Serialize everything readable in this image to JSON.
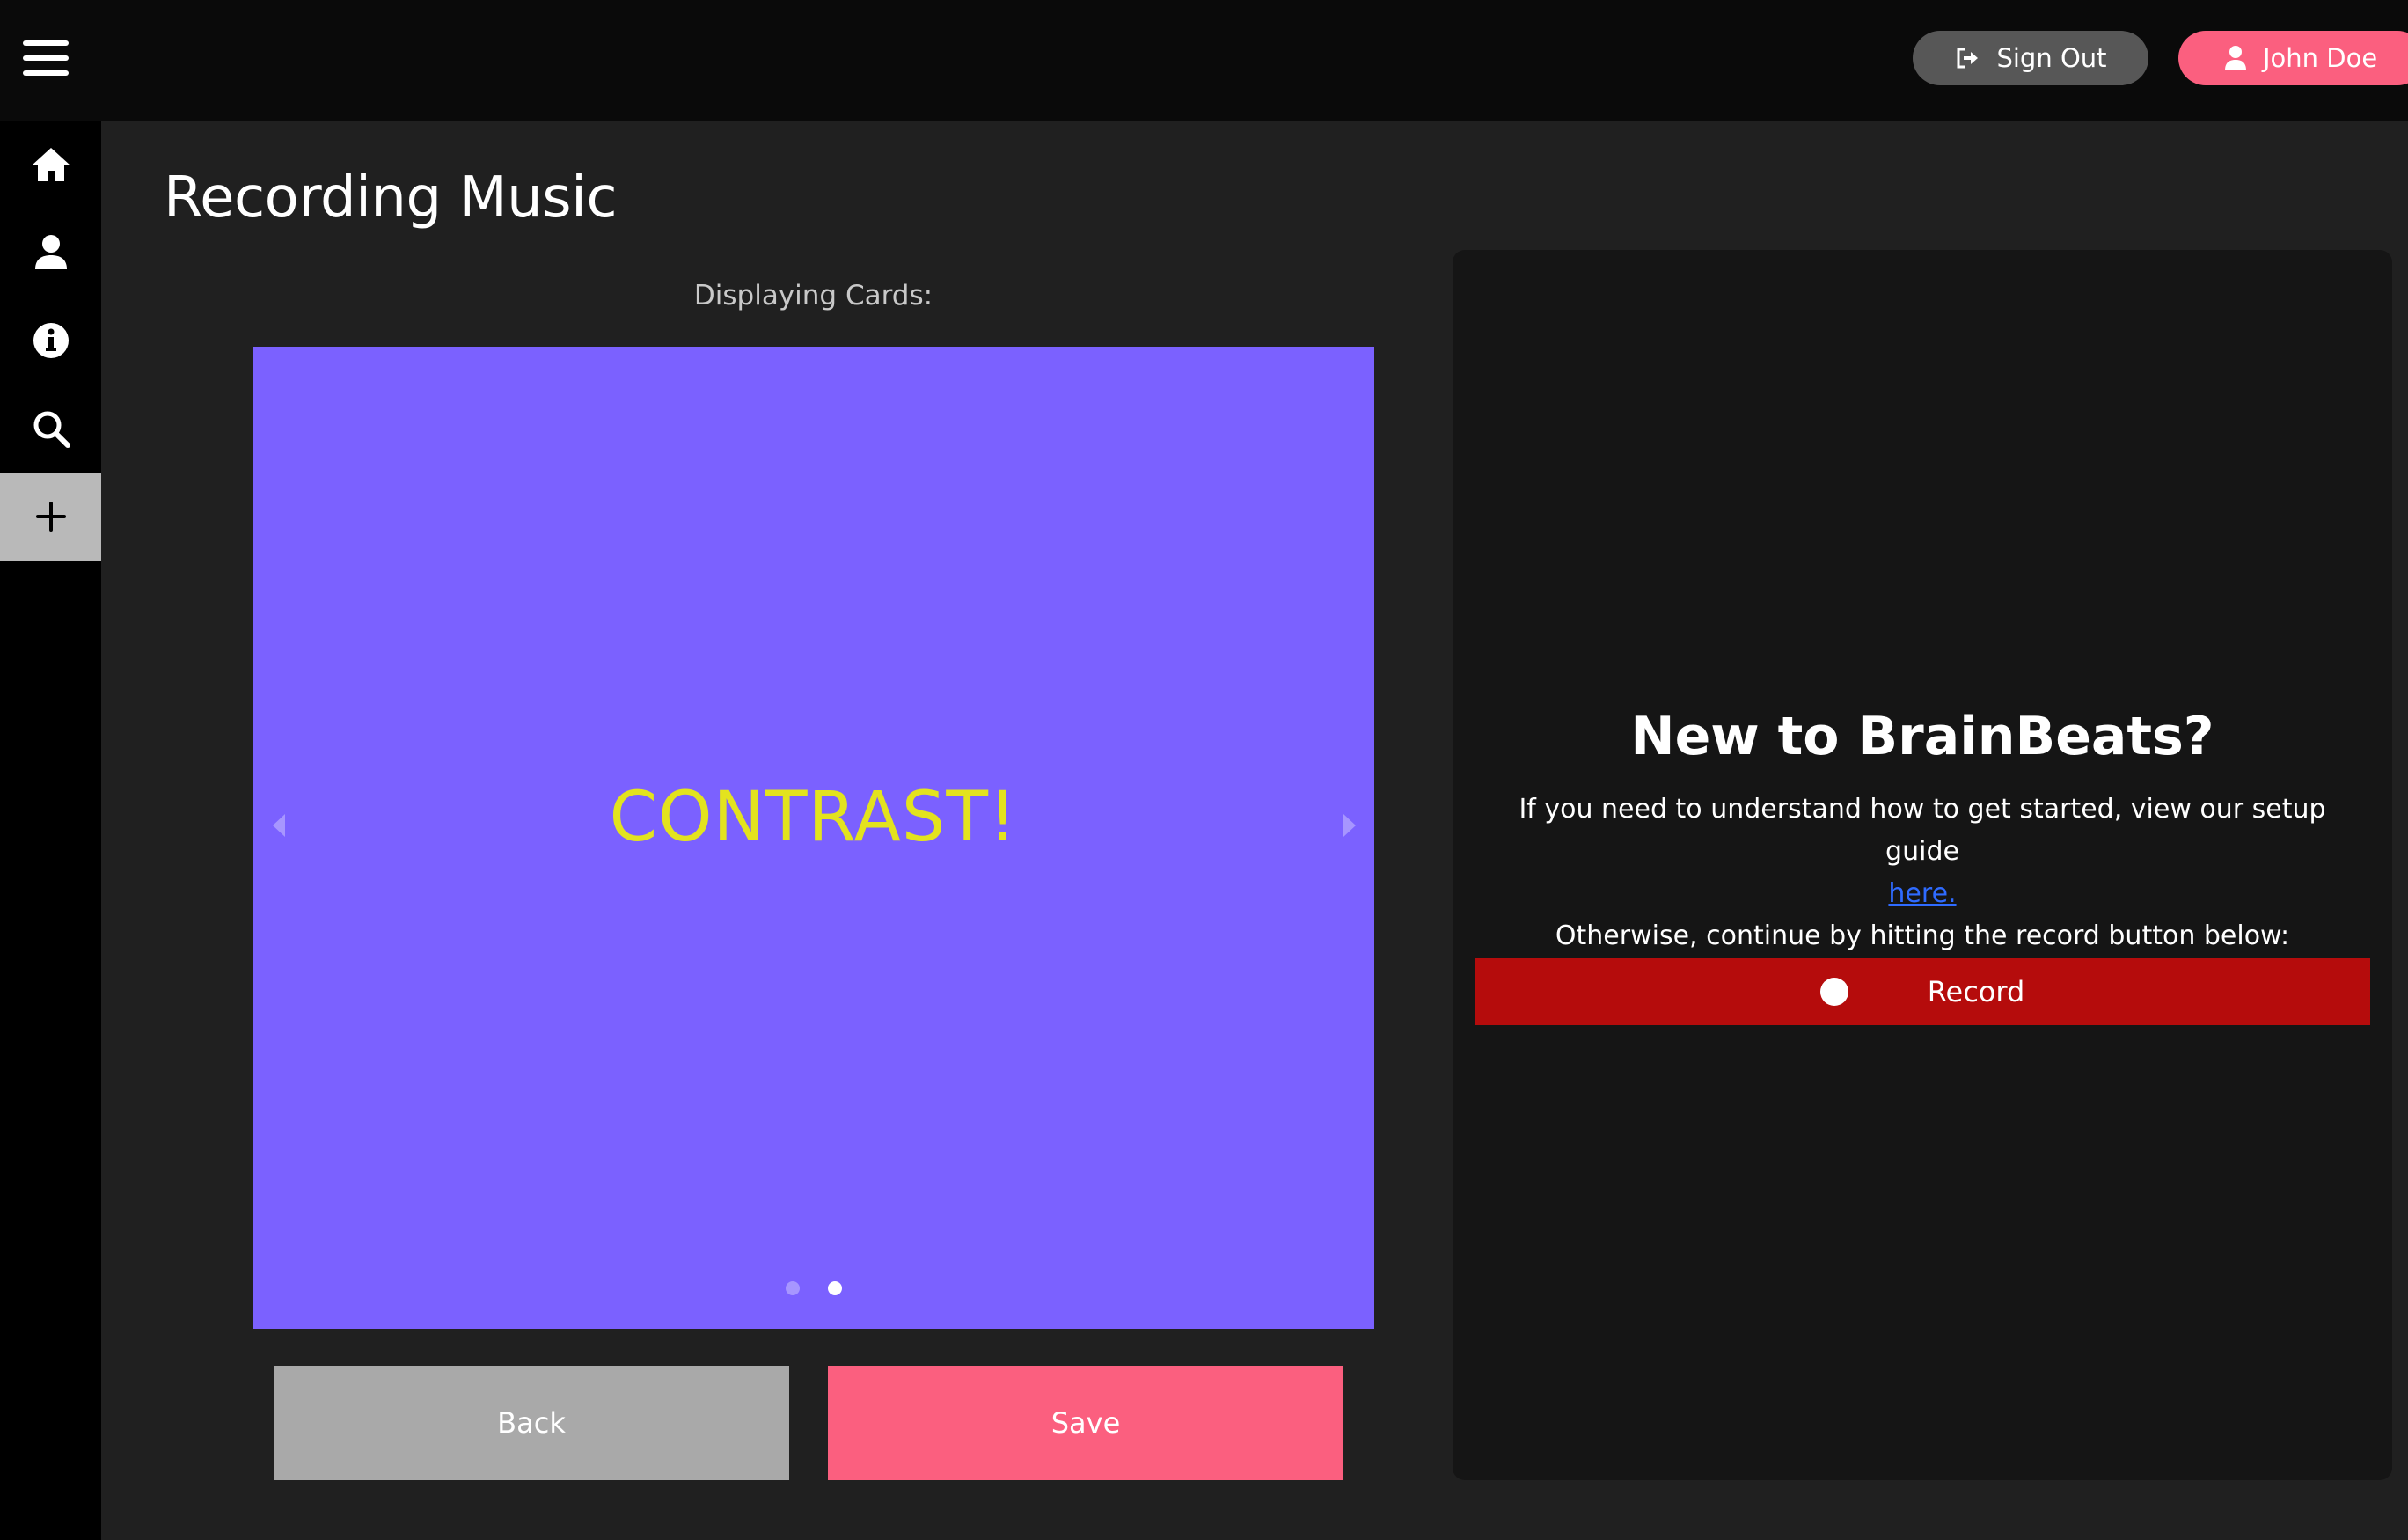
{
  "header": {
    "sign_out_label": "Sign Out",
    "user_label": "John Doe",
    "icons": {
      "menu": "hamburger-menu-icon",
      "sign_out": "sign-out-icon",
      "user": "user-icon"
    }
  },
  "sidebar": {
    "items": [
      {
        "icon": "home-icon",
        "active": false
      },
      {
        "icon": "profile-icon",
        "active": false
      },
      {
        "icon": "info-icon",
        "active": false
      },
      {
        "icon": "search-icon",
        "active": false
      },
      {
        "icon": "plus-icon",
        "active": true
      }
    ]
  },
  "main": {
    "title": "Recording Music",
    "cards_label": "Displaying Cards:",
    "card": {
      "text": "CONTRAST!",
      "background": "#7b61ff",
      "text_color": "#e3e31e",
      "slide_count": 2,
      "active_slide": 2
    },
    "back_label": "Back",
    "save_label": "Save"
  },
  "panel": {
    "title": "New to BrainBeats?",
    "intro_text": "If you need to understand how to get started, view our setup guide",
    "link_text": "here.",
    "continue_text": "Otherwise, continue by hitting the record button below:",
    "record_label": "Record"
  },
  "colors": {
    "accent_pink": "#fb5f7f",
    "record_red": "#b50c0c",
    "link_blue": "#2f6bff"
  }
}
